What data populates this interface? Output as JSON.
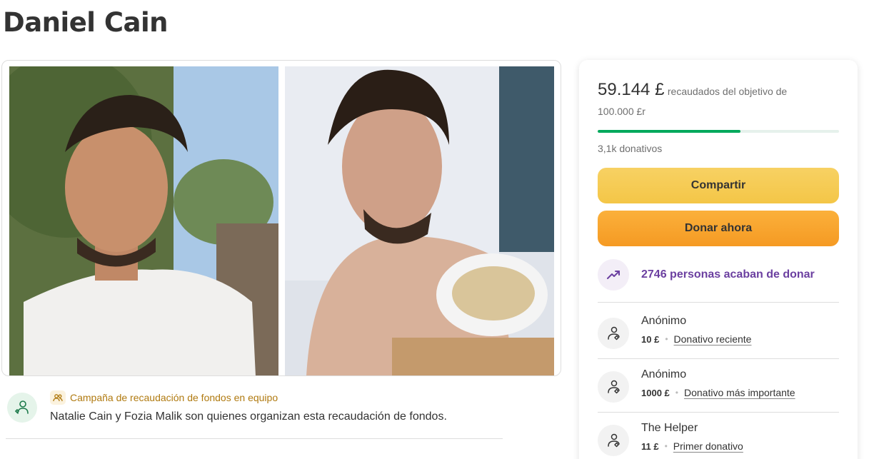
{
  "page": {
    "title": "Daniel Cain"
  },
  "photos": [
    {
      "name": "photo-daniel-outdoors"
    },
    {
      "name": "photo-daniel-hospital"
    }
  ],
  "campaign": {
    "team_label": "Campaña de recaudación de fondos en equipo",
    "organizers": "Natalie Cain y Fozia Malik son quienes organizan esta recaudación de fondos."
  },
  "donation_card": {
    "raised_amount": "59.144 £",
    "raised_text": "recaudados del objetivo de",
    "goal": "100.000 £r",
    "progress_fraction": 0.59144,
    "donations_count": "3,1k donativos",
    "share_label": "Compartir",
    "donate_label": "Donar ahora",
    "recent_donors_text": "2746 personas acaban de donar",
    "donors": [
      {
        "name": "Anónimo",
        "amount": "10 £",
        "tag": "Donativo reciente"
      },
      {
        "name": "Anónimo",
        "amount": "1000 £",
        "tag": "Donativo más importante"
      },
      {
        "name": "The Helper",
        "amount": "11 £",
        "tag": "Primer donativo"
      }
    ]
  },
  "colors": {
    "progress": "#02a95c",
    "share_button": "#f4c647",
    "donate_button": "#f59a23",
    "recent_accent": "#6b3fa0",
    "team_label": "#b07a10"
  }
}
